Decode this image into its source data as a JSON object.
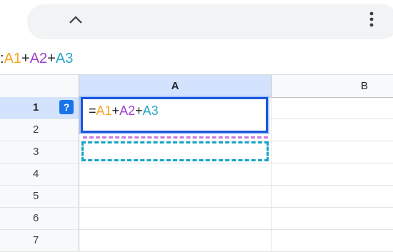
{
  "toolbar": {
    "collapse_icon": "chevron-up-icon",
    "more_icon": "more-vert-icon"
  },
  "formula_bar": {
    "leading": ":",
    "ref1": "A1",
    "op1": "+",
    "ref2": "A2",
    "op2": "+",
    "ref3": "A3"
  },
  "editor": {
    "equals": "=",
    "ref1": "A1",
    "op1": "+",
    "ref2": "A2",
    "op2": "+",
    "ref3": "A3"
  },
  "columns": [
    {
      "label": "A"
    },
    {
      "label": "B"
    }
  ],
  "rows": [
    {
      "label": "1"
    },
    {
      "label": "2"
    },
    {
      "label": "3"
    },
    {
      "label": "4"
    },
    {
      "label": "5"
    },
    {
      "label": "6"
    },
    {
      "label": "7"
    }
  ],
  "help_badge": "?",
  "colors": {
    "ref_a1": "#f5a623",
    "ref_a2": "#a142c9",
    "ref_a3": "#26a7c9",
    "selection": "#1a56db"
  }
}
